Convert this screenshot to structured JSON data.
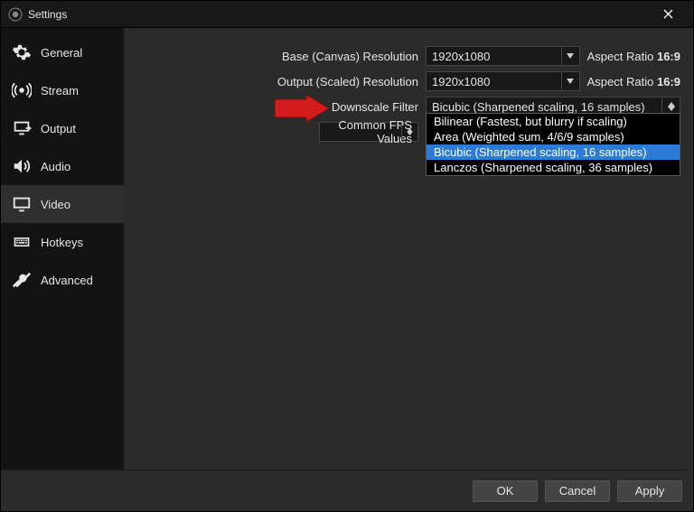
{
  "window": {
    "title": "Settings"
  },
  "sidebar": {
    "items": [
      {
        "label": "General"
      },
      {
        "label": "Stream"
      },
      {
        "label": "Output"
      },
      {
        "label": "Audio"
      },
      {
        "label": "Video"
      },
      {
        "label": "Hotkeys"
      },
      {
        "label": "Advanced"
      }
    ],
    "selected_index": 4
  },
  "video": {
    "base_label": "Base (Canvas) Resolution",
    "base_value": "1920x1080",
    "scaled_label": "Output (Scaled) Resolution",
    "scaled_value": "1920x1080",
    "aspect_label": "Aspect Ratio",
    "aspect_value": "16:9",
    "downscale_label": "Downscale Filter",
    "downscale_value": "Bicubic (Sharpened scaling, 16 samples)",
    "downscale_options": [
      "Bilinear (Fastest, but blurry if scaling)",
      "Area (Weighted sum, 4/6/9 samples)",
      "Bicubic (Sharpened scaling, 16 samples)",
      "Lanczos (Sharpened scaling, 36 samples)"
    ],
    "fps_label": "Common FPS Values"
  },
  "footer": {
    "ok": "OK",
    "cancel": "Cancel",
    "apply": "Apply"
  }
}
